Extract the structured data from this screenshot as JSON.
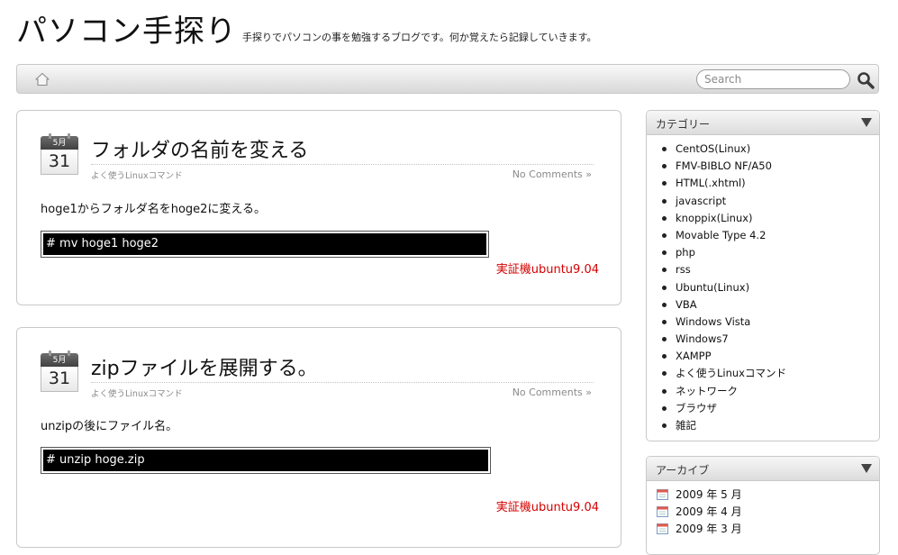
{
  "header": {
    "title": "パソコン手探り",
    "description": "手探りでパソコンの事を勉強するブログです。何か覚えたら記録していきます。"
  },
  "nav": {
    "home_icon": "home-icon",
    "search_placeholder": "Search",
    "search_icon": "search-icon"
  },
  "posts": [
    {
      "month": "5月",
      "day": "31",
      "title": "フォルダの名前を変える",
      "category": "よく使うLinuxコマンド",
      "comments": "No Comments »",
      "text": "hoge1からフォルダ名をhoge2に変える。",
      "code": "# mv hoge1 hoge2",
      "note": "実証機ubuntu9.04"
    },
    {
      "month": "5月",
      "day": "31",
      "title": "zipファイルを展開する。",
      "category": "よく使うLinuxコマンド",
      "comments": "No Comments »",
      "text": "unzipの後にファイル名。",
      "code": "# unzip hoge.zip",
      "note": "実証機ubuntu9.04"
    }
  ],
  "sidebar": {
    "categories": {
      "title": "カテゴリー",
      "items": [
        "CentOS(Linux)",
        "FMV-BIBLO NF/A50",
        "HTML(.xhtml)",
        "javascript",
        "knoppix(Linux)",
        "Movable Type 4.2",
        "php",
        "rss",
        "Ubuntu(Linux)",
        "VBA",
        "Windows Vista",
        "Windows7",
        "XAMPP",
        "よく使うLinuxコマンド",
        "ネットワーク",
        "ブラウザ",
        "雑記"
      ]
    },
    "archives": {
      "title": "アーカイブ",
      "items": [
        "2009 年 5 月",
        "2009 年 4 月",
        "2009 年 3 月"
      ]
    }
  },
  "colors": {
    "note_red": "#d40000",
    "code_bg": "#000000",
    "meta_gray": "#8a8a8a"
  }
}
